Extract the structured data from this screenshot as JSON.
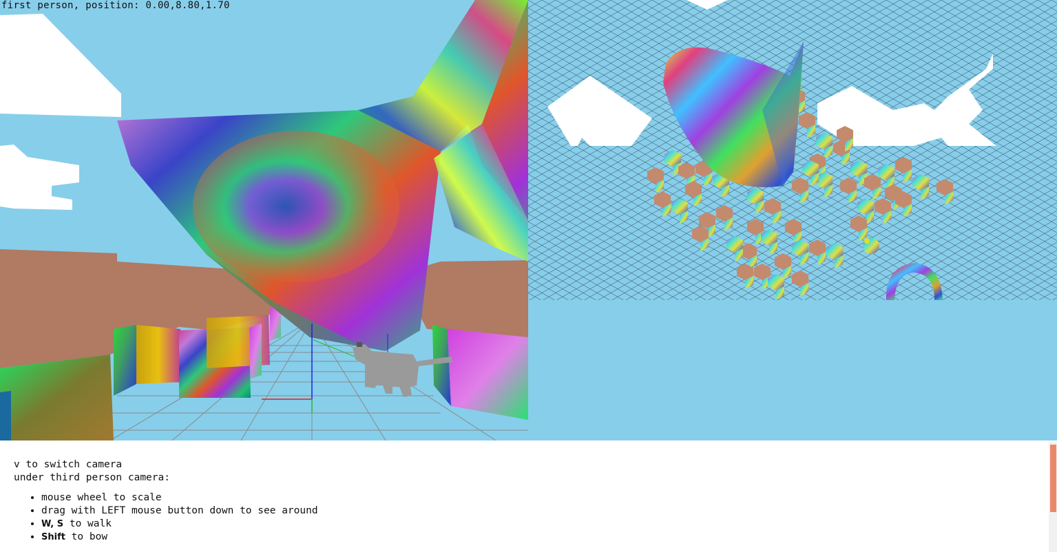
{
  "hud": {
    "camera_status": "first person, position: 0.00,8.80,1.70"
  },
  "instructions": {
    "line1": "v to switch camera",
    "line2": "under third person camera:",
    "items": [
      {
        "key": "",
        "text": "mouse wheel to scale"
      },
      {
        "key": "",
        "text": "drag with LEFT mouse button down to see around"
      },
      {
        "key": "W, S",
        "text": " to walk"
      },
      {
        "key": "Shift",
        "text": " to bow"
      }
    ]
  },
  "colors": {
    "sky": "#87ceeb",
    "building": "#b07a63",
    "grid": "#6e8c96",
    "scroll_thumb": "#e9896a"
  }
}
